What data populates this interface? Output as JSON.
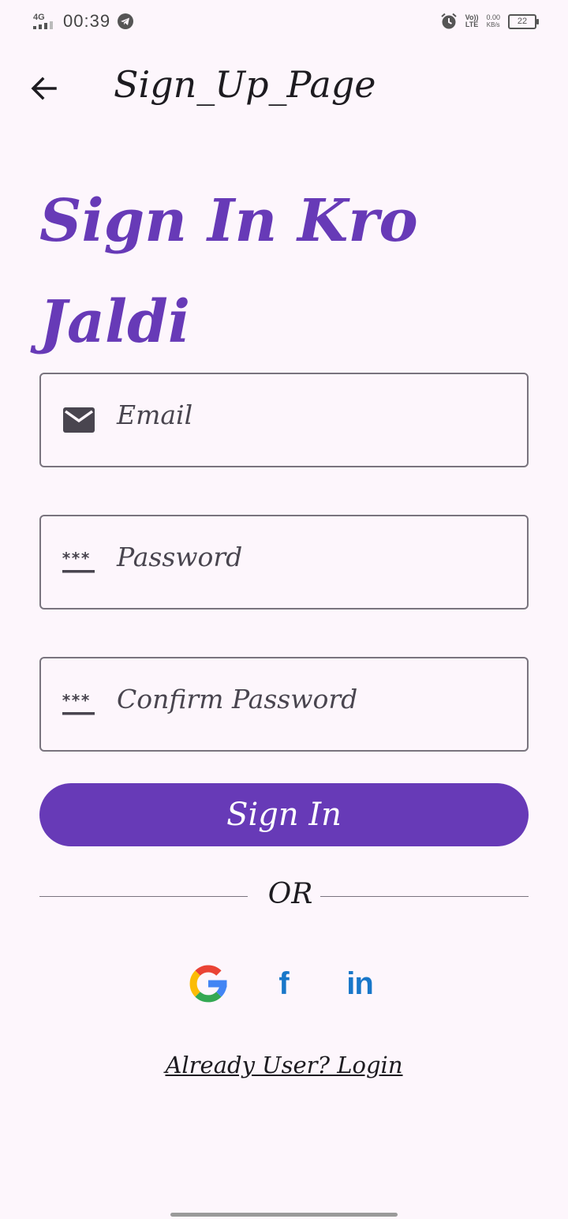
{
  "status_bar": {
    "network": "4G",
    "time": "00:39",
    "volte_top": "Vo))",
    "volte_bottom": "LTE",
    "speed_value": "0.00",
    "speed_unit": "KB/s",
    "battery": "22"
  },
  "app_bar": {
    "title": "Sign_Up_Page"
  },
  "headline": "Sign In Kro Jaldi",
  "form": {
    "email_placeholder": "Email",
    "password_placeholder": "Password",
    "confirm_password_placeholder": "Confirm Password",
    "submit_label": "Sign In"
  },
  "divider_label": "OR",
  "social": {
    "facebook_label": "f",
    "linkedin_label": "in"
  },
  "login_link": "Already User? Login",
  "colors": {
    "accent": "#673ab7",
    "background": "#fdf6fc",
    "outline": "#79747e"
  }
}
